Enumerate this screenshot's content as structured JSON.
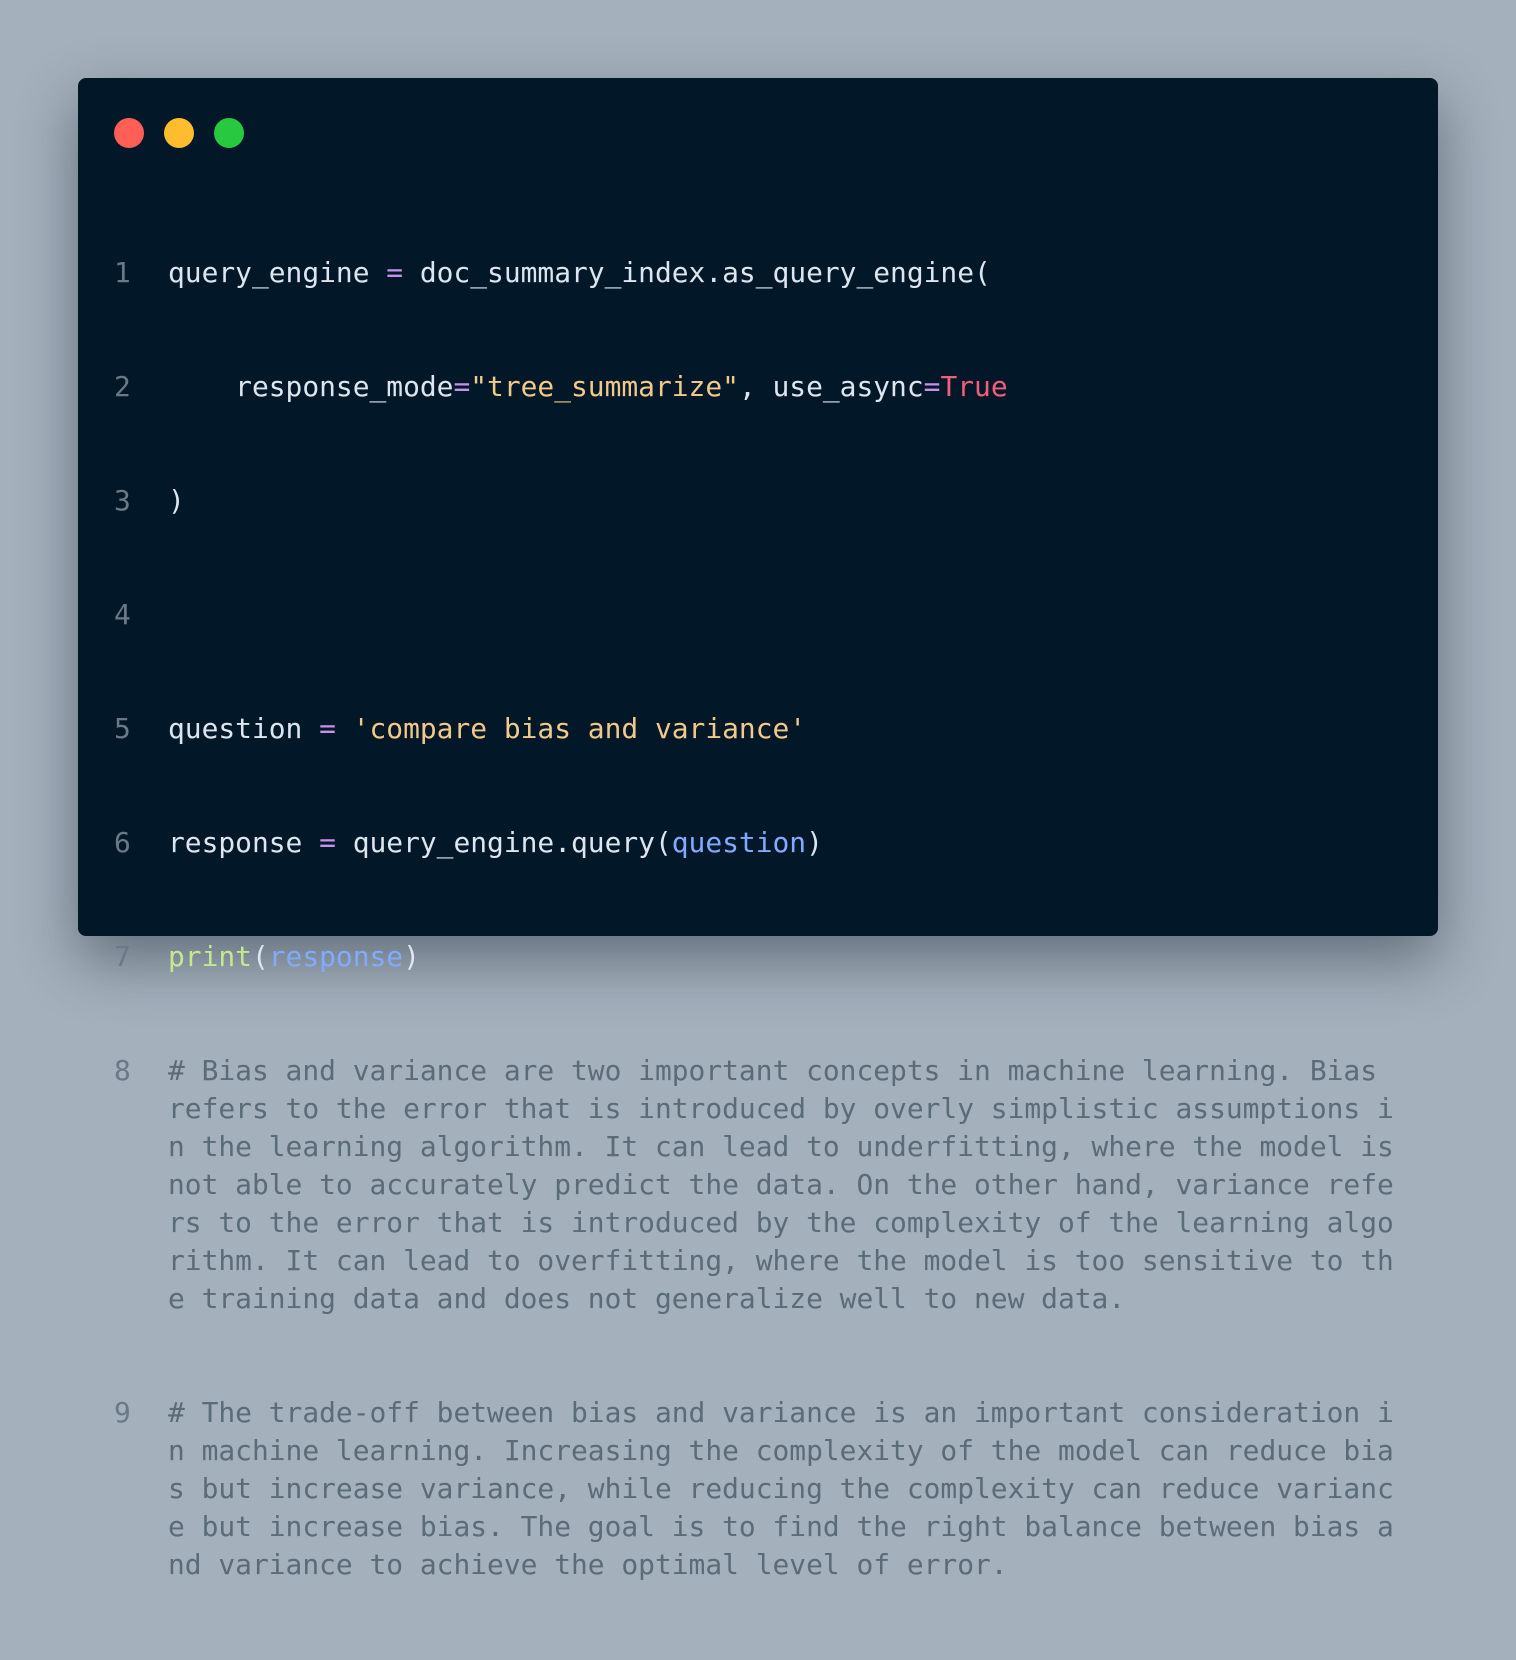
{
  "window": {
    "controls": [
      "close",
      "minimize",
      "maximize"
    ]
  },
  "code": {
    "line_numbers": [
      "1",
      "2",
      "3",
      "4",
      "5",
      "6",
      "7",
      "8",
      "9"
    ],
    "l1": {
      "a": "query_engine ",
      "eq": "=",
      "b": " doc_summary_index.as_query_engine("
    },
    "l2": {
      "a": "    response_mode",
      "eq": "=",
      "s": "\"tree_summarize\"",
      "b": ", use_async",
      "eq2": "=",
      "kw": "True"
    },
    "l3": {
      "a": ")"
    },
    "l5": {
      "a": "question ",
      "eq": "=",
      "b": " ",
      "s": "'compare bias and variance'"
    },
    "l6": {
      "a": "response ",
      "eq": "=",
      "b": " query_engine.query(",
      "arg": "question",
      "c": ")"
    },
    "l7": {
      "fn": "print",
      "a": "(",
      "arg": "response",
      "c": ")"
    },
    "l8": "# Bias and variance are two important concepts in machine learning. Bias refers to the error that is introduced by overly simplistic assumptions in the learning algorithm. It can lead to underfitting, where the model is not able to accurately predict the data. On the other hand, variance refers to the error that is introduced by the complexity of the learning algorithm. It can lead to overfitting, where the model is too sensitive to the training data and does not generalize well to new data.",
    "l9": "# The trade-off between bias and variance is an important consideration in machine learning. Increasing the complexity of the model can reduce bias but increase variance, while reducing the complexity can reduce variance but increase bias. The goal is to find the right balance between bias and variance to achieve the optimal level of error."
  }
}
